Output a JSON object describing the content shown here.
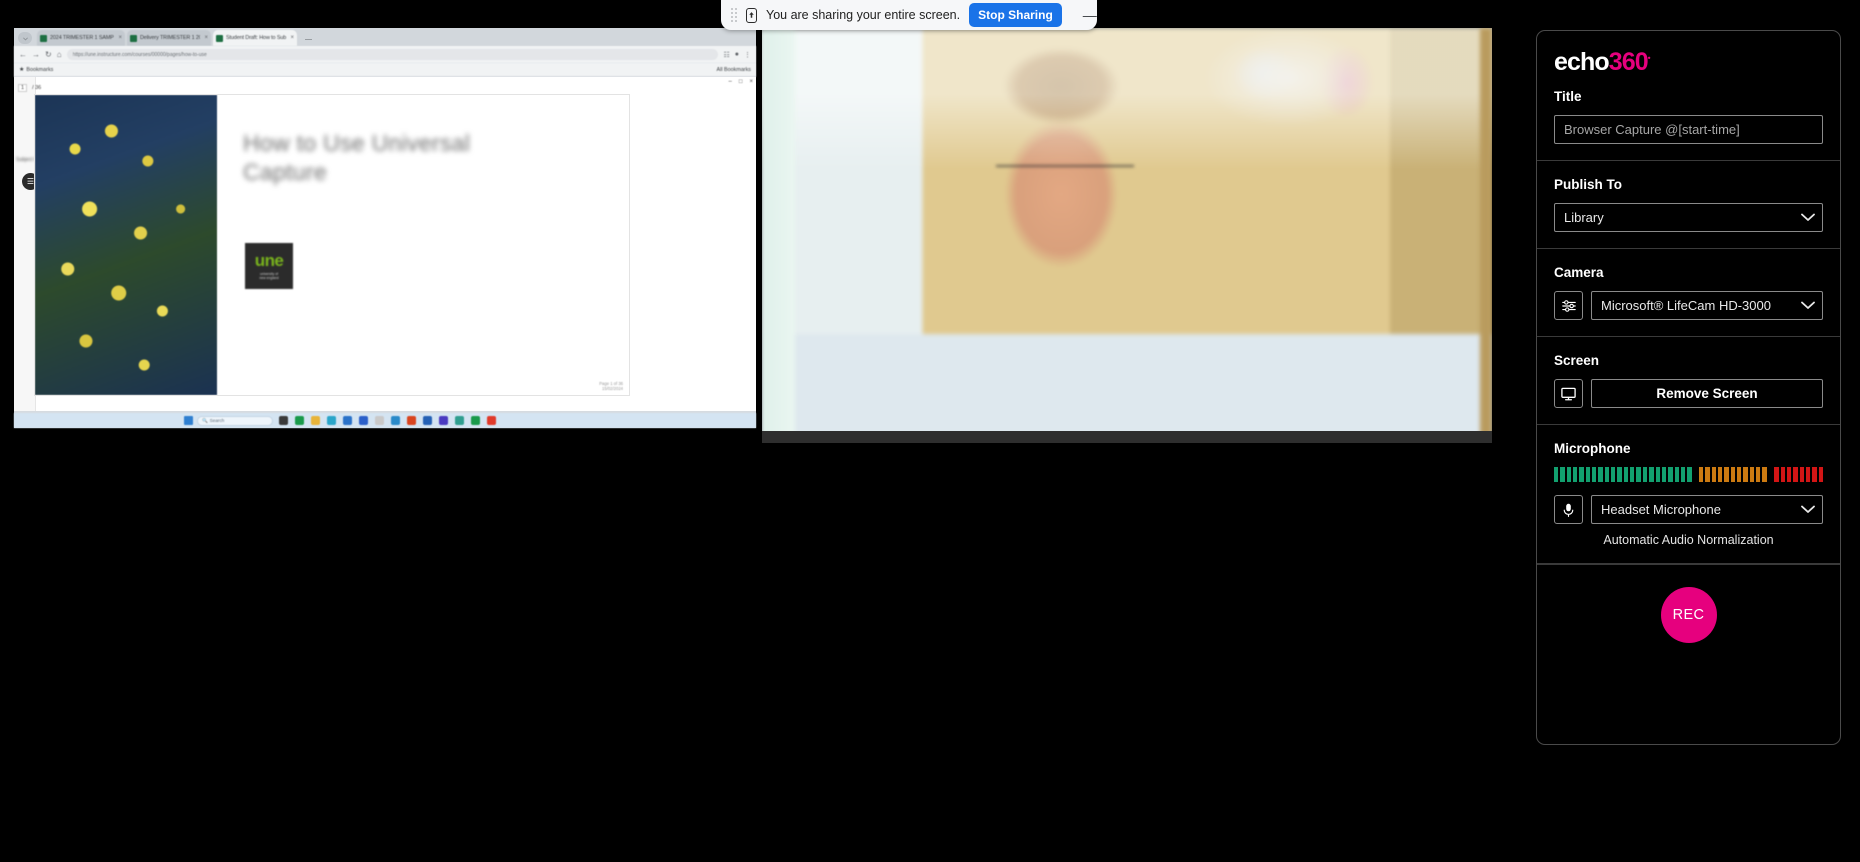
{
  "sharing_bar": {
    "message": "You are sharing your entire screen.",
    "stop_label": "Stop Sharing",
    "minimize_label": "—"
  },
  "shared_screen": {
    "browser": {
      "tabs": [
        {
          "title": "2024 TRIMESTER 1 SAMPLE M...",
          "active": false,
          "close": "×"
        },
        {
          "title": "Delivery TRIMESTER 1 2024 SA...",
          "active": false,
          "close": "×"
        },
        {
          "title": "Student Draft: How to Submit...",
          "active": true,
          "close": "×"
        }
      ],
      "minimize_glyph": "—",
      "nav": {
        "back": "←",
        "forward": "→",
        "reload": "↻",
        "home": "⌂"
      },
      "omnibox_url": "https://une.instructure.com/courses/00000/pages/how-to-use",
      "bookmarks_label": "Bookmarks",
      "all_bookmarks_label": "All Bookmarks",
      "window_controls": {
        "minimize": "–",
        "maximize": "□",
        "close": "×"
      }
    },
    "viewer": {
      "page_indicator": "1",
      "page_total": "/ 36",
      "menu_glyph": "☰",
      "sidebar_note": "Subject Guide materials"
    },
    "slide": {
      "title": "How to Use Universal Capture",
      "logo_text": "une",
      "logo_sub": "university of\nnew england",
      "footer": "Page 1 of 36\n15/02/2024"
    },
    "taskbar": {
      "search_placeholder": "Search",
      "search_icon": "search-icon"
    }
  },
  "webcam": {
    "alt": "Presenter on webcam in front of corkboard"
  },
  "panel": {
    "logo": {
      "word": "echo",
      "number": "360",
      "trademark": "•"
    },
    "title_section": {
      "label": "Title",
      "value": "",
      "placeholder": "Browser Capture @[start-time]"
    },
    "publish_section": {
      "label": "Publish To",
      "selected": "Library"
    },
    "camera_section": {
      "label": "Camera",
      "selected": "Microsoft® LifeCam HD-3000",
      "settings_icon": "camera-settings-icon"
    },
    "screen_section": {
      "label": "Screen",
      "button_label": "Remove Screen",
      "monitor_icon": "monitor-icon"
    },
    "microphone_section": {
      "label": "Microphone",
      "selected": "Headset Microphone",
      "mic_icon": "microphone-icon",
      "auto_normalization_label": "Automatic Audio Normalization",
      "meter": {
        "green_count": 22,
        "orange_count": 11,
        "red_count": 8,
        "green_color": "#12a06f",
        "orange_color": "#cc7a11",
        "red_color": "#d31515"
      }
    },
    "record": {
      "label": "REC",
      "color": "#e6007e"
    }
  }
}
